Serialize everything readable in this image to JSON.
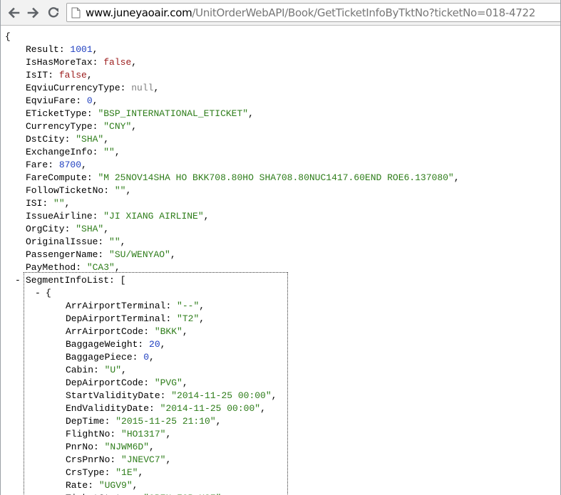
{
  "browser": {
    "url_host": "www.juneyaoair.com",
    "url_path": "/UnitOrderWebAPI/Book/GetTicketInfoByTktNo?ticketNo=018-4722",
    "icons": [
      "back-arrow-icon",
      "forward-arrow-icon",
      "reload-icon",
      "page-icon"
    ]
  },
  "json_view": {
    "open_brace": "{",
    "top_fields": [
      {
        "key": "Result",
        "value": "1001",
        "type": "num"
      },
      {
        "key": "IsHasMoreTax",
        "value": "false",
        "type": "bool"
      },
      {
        "key": "IsIT",
        "value": "false",
        "type": "bool"
      },
      {
        "key": "EqviuCurrencyType",
        "value": "null",
        "type": "nul"
      },
      {
        "key": "EqviuFare",
        "value": "0",
        "type": "num"
      },
      {
        "key": "ETicketType",
        "value": "\"BSP_INTERNATIONAL_ETICKET\"",
        "type": "str"
      },
      {
        "key": "CurrencyType",
        "value": "\"CNY\"",
        "type": "str"
      },
      {
        "key": "DstCity",
        "value": "\"SHA\"",
        "type": "str"
      },
      {
        "key": "ExchangeInfo",
        "value": "\"\"",
        "type": "str"
      },
      {
        "key": "Fare",
        "value": "8700",
        "type": "num"
      },
      {
        "key": "FareCompute",
        "value": "\"M 25NOV14SHA HO BKK708.80HO SHA708.80NUC1417.60END ROE6.137080\"",
        "type": "str"
      },
      {
        "key": "FollowTicketNo",
        "value": "\"\"",
        "type": "str"
      },
      {
        "key": "ISI",
        "value": "\"\"",
        "type": "str"
      },
      {
        "key": "IssueAirline",
        "value": "\"JI XIANG AIRLINE\"",
        "type": "str"
      },
      {
        "key": "OrgCity",
        "value": "\"SHA\"",
        "type": "str"
      },
      {
        "key": "OriginalIssue",
        "value": "\"\"",
        "type": "str"
      },
      {
        "key": "PassengerName",
        "value": "\"SU/WENYAO\"",
        "type": "str"
      },
      {
        "key": "PayMethod",
        "value": "\"CA3\"",
        "type": "str"
      }
    ],
    "segment_list_key": "SegmentInfoList",
    "open_bracket": "[",
    "collapse_symbol": "-",
    "segment_open": "{",
    "segment_fields": [
      {
        "key": "ArrAirportTerminal",
        "value": "\"--\"",
        "type": "str"
      },
      {
        "key": "DepAirportTerminal",
        "value": "\"T2\"",
        "type": "str"
      },
      {
        "key": "ArrAirportCode",
        "value": "\"BKK\"",
        "type": "str"
      },
      {
        "key": "BaggageWeight",
        "value": "20",
        "type": "num"
      },
      {
        "key": "BaggagePiece",
        "value": "0",
        "type": "num"
      },
      {
        "key": "Cabin",
        "value": "\"U\"",
        "type": "str"
      },
      {
        "key": "DepAirportCode",
        "value": "\"PVG\"",
        "type": "str"
      },
      {
        "key": "StartValidityDate",
        "value": "\"2014-11-25 00:00\"",
        "type": "str"
      },
      {
        "key": "EndValidityDate",
        "value": "\"2014-11-25 00:00\"",
        "type": "str"
      },
      {
        "key": "DepTime",
        "value": "\"2015-11-25 21:10\"",
        "type": "str"
      },
      {
        "key": "FlightNo",
        "value": "\"HO1317\"",
        "type": "str"
      },
      {
        "key": "PnrNo",
        "value": "\"NJWM6D\"",
        "type": "str"
      },
      {
        "key": "CrsPnrNo",
        "value": "\"JNEVC7\"",
        "type": "str"
      },
      {
        "key": "CrsType",
        "value": "\"1E\"",
        "type": "str"
      },
      {
        "key": "Rate",
        "value": "\"UGV9\"",
        "type": "str"
      },
      {
        "key": "TicketStatus",
        "value": "\"OPEN FOR USE\"",
        "type": "str"
      }
    ]
  }
}
